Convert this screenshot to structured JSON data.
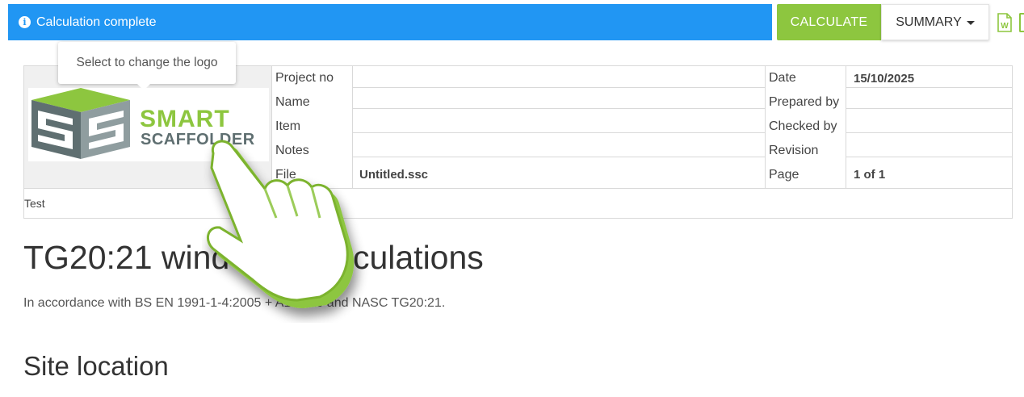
{
  "status": {
    "message": "Calculation complete",
    "icon": "info-icon",
    "color": "#2196f3"
  },
  "toolbar": {
    "calculate_label": "CALCULATE",
    "summary_label": "SUMMARY",
    "accent": "#8dc63f",
    "export_icon": "word-document-icon"
  },
  "tooltip": {
    "text": "Select to change the logo"
  },
  "logo": {
    "line1": "SMART",
    "line2": "SCAFFOLDER"
  },
  "header": {
    "left_labels": {
      "project_no": "Project no",
      "name": "Name",
      "item": "Item",
      "notes": "Notes",
      "file": "File"
    },
    "file_value": "Untitled.ssc",
    "right_labels": {
      "date": "Date",
      "prepared_by": "Prepared by",
      "checked_by": "Checked by",
      "revision": "Revision",
      "page": "Page"
    },
    "date_value": "15/10/2025",
    "page_value": "1 of 1",
    "notes_text": "Test"
  },
  "content": {
    "title": "TG20:21 wind load calculations",
    "subtitle": "In accordance with BS EN 1991-1-4:2005 + A1:2010 and NASC TG20:21.",
    "section_title": "Site location"
  }
}
